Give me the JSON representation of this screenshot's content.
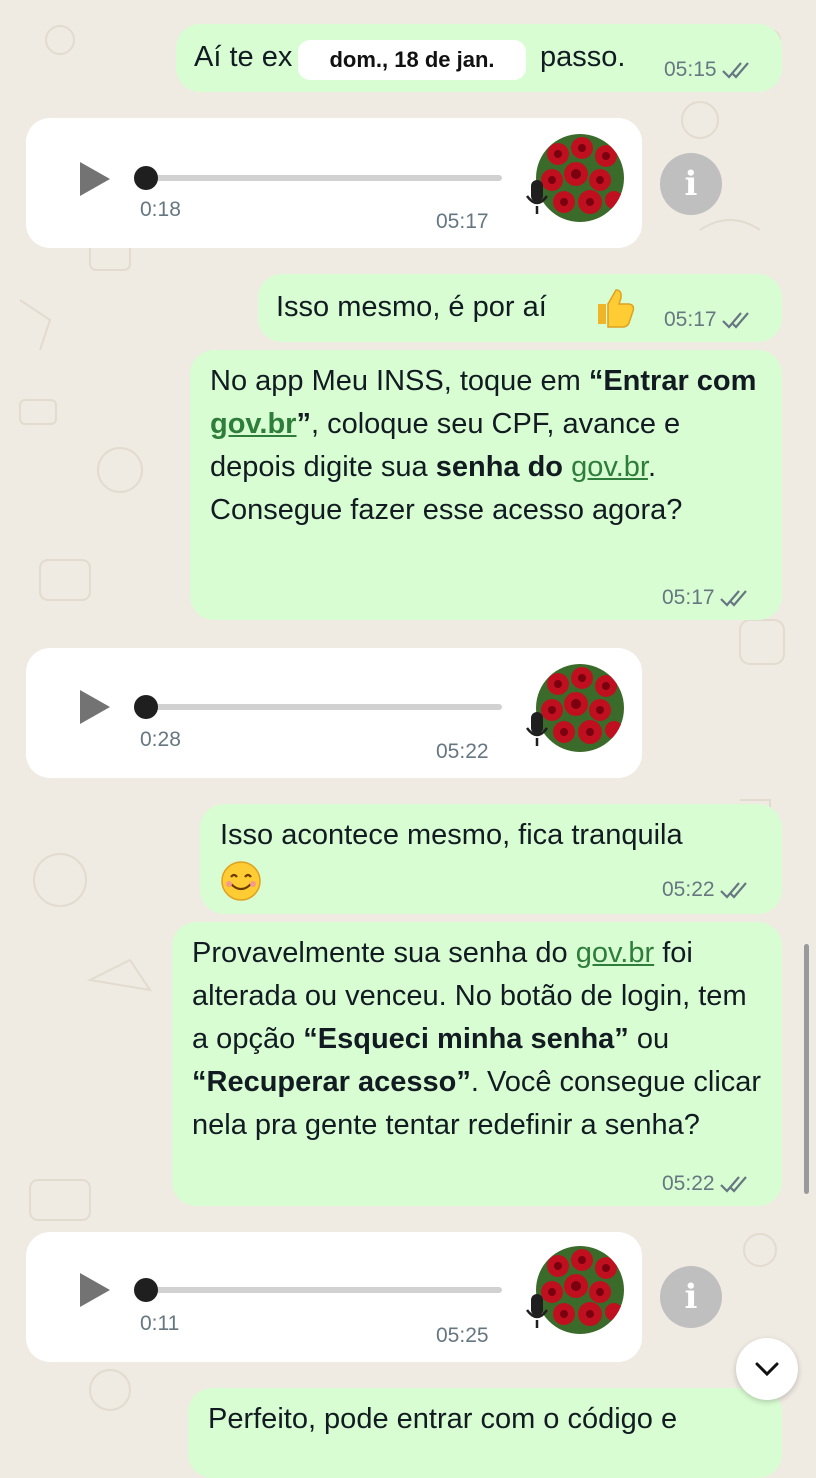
{
  "date_divider": "dom., 18 de jan.",
  "messages": [
    {
      "type": "text",
      "dir": "out",
      "text_before": "Aí te ex",
      "text_after": "passo.",
      "time": "05:15"
    },
    {
      "type": "audio",
      "dir": "in",
      "duration": "0:18",
      "time": "05:17"
    },
    {
      "type": "text",
      "dir": "out",
      "text": "Isso mesmo, é por aí",
      "emoji": "thumbs-up",
      "time": "05:17"
    },
    {
      "type": "rich",
      "dir": "out",
      "time": "05:17",
      "p1": "No app Meu INSS, toque em ",
      "b1": "“Entrar com ",
      "link1": "gov.br",
      "b1_end": "”",
      "p2": ", coloque seu CPF, avance e depois digite sua ",
      "b2": "senha do",
      "link2": "gov.br",
      "p3": ".",
      "p4": "Consegue fazer esse acesso agora?"
    },
    {
      "type": "audio",
      "dir": "in",
      "duration": "0:28",
      "time": "05:22"
    },
    {
      "type": "text",
      "dir": "out",
      "text": "Isso acontece mesmo, fica tranquila",
      "emoji": "smiling-face",
      "time": "05:22"
    },
    {
      "type": "rich",
      "dir": "out",
      "time": "05:22",
      "p1": "Provavelmente sua senha do ",
      "link1": "gov.br",
      "p2": " foi alterada ou venceu. No botão de login, tem a opção ",
      "b1": "“Esqueci minha senha”",
      "p3": " ou ",
      "b2": "“Recuperar acesso”",
      "p4": ". Você consegue clicar nela pra gente tentar redefinir a senha?"
    },
    {
      "type": "audio",
      "dir": "in",
      "duration": "0:11",
      "time": "05:25"
    },
    {
      "type": "text",
      "dir": "out",
      "text": "Perfeito, pode entrar com o código e"
    }
  ],
  "icons": {
    "play": "play-icon",
    "mic": "microphone-icon",
    "info": "info-icon",
    "ticks": "double-check-icon",
    "scroll_down": "chevron-down-icon"
  },
  "colors": {
    "outgoing": "#d9fdd3",
    "incoming": "#ffffff",
    "background": "#efeae2",
    "link": "#2e7d3a",
    "meta": "#667781"
  }
}
